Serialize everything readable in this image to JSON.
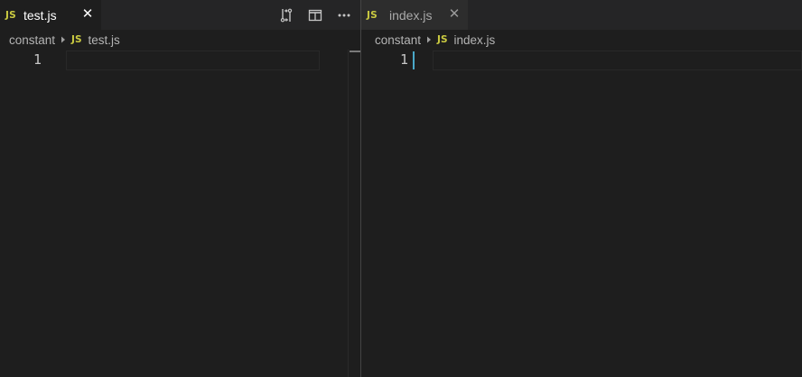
{
  "left_group": {
    "tab": {
      "icon": "js-icon",
      "icon_text": "JS",
      "label": "test.js",
      "close_icon": "close-icon",
      "close_glyph": "✕"
    },
    "actions": [
      {
        "name": "compare-changes-icon"
      },
      {
        "name": "split-editor-icon"
      },
      {
        "name": "more-actions-icon"
      }
    ],
    "breadcrumb": {
      "folder": "constant",
      "separator_icon": "chevron-right-icon",
      "file_icon_text": "JS",
      "file": "test.js"
    },
    "editor": {
      "line_number": "1"
    }
  },
  "right_group": {
    "tab": {
      "icon": "js-icon",
      "icon_text": "JS",
      "label": "index.js",
      "close_icon": "close-icon",
      "close_glyph": "✕"
    },
    "breadcrumb": {
      "folder": "constant",
      "separator_icon": "chevron-right-icon",
      "file_icon_text": "JS",
      "file": "index.js"
    },
    "editor": {
      "line_number": "1"
    }
  },
  "colors": {
    "editor_bg": "#1e1e1e",
    "tabbar_bg": "#252526",
    "inactive_tab_bg": "#2d2d2d",
    "js_icon": "#cbcb41",
    "cursor": "#4aa8c8"
  }
}
